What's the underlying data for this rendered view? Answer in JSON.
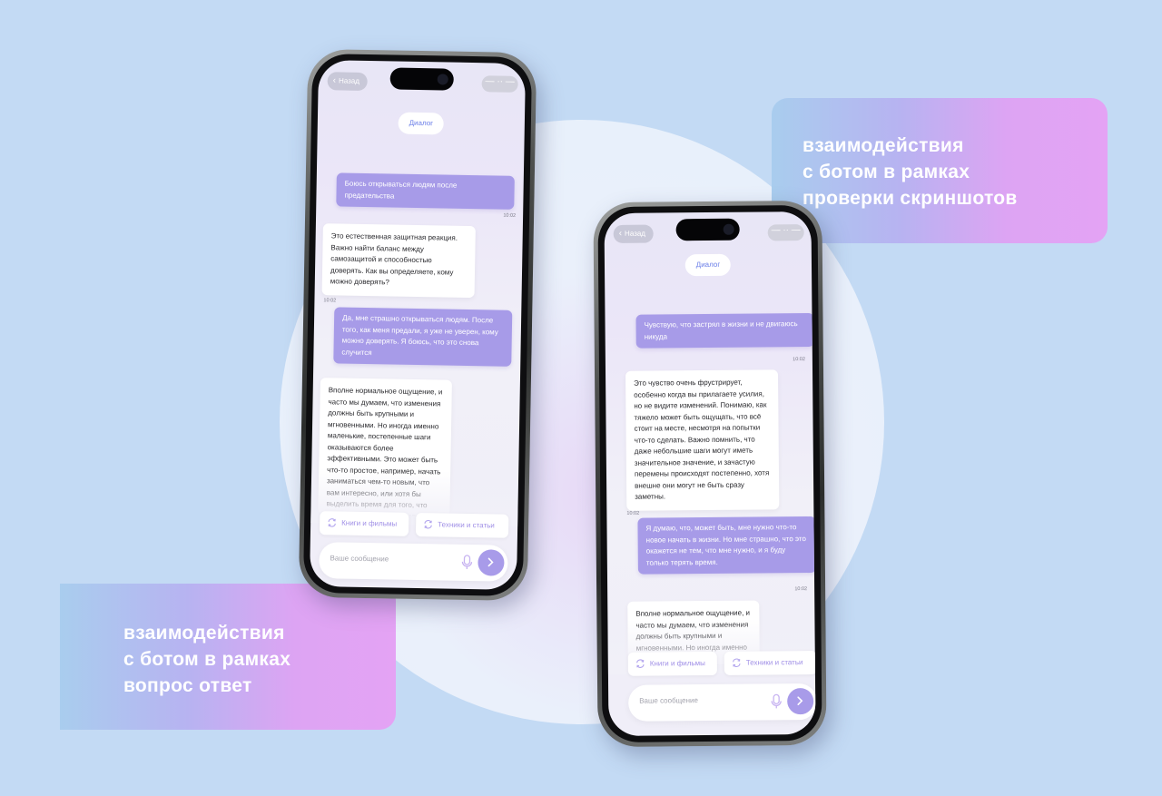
{
  "captions": {
    "right": [
      "взаимодействия",
      "с ботом в рамках",
      "проверки скриншотов"
    ],
    "left": [
      "взаимодействия",
      "с ботом в рамках",
      "вопрос ответ"
    ]
  },
  "phone1": {
    "back_label": "Назад",
    "right_pill": "— ·· —",
    "title": "Диалог",
    "messages": [
      {
        "role": "user",
        "text": "Боюсь открываться людям после предательства",
        "time": "10:02"
      },
      {
        "role": "bot",
        "text": "Это естественная защитная реакция. Важно найти баланс между самозащитой и способностью доверять. Как вы определяете, кому можно доверять?",
        "time": "10:02"
      },
      {
        "role": "user",
        "text": "Да, мне страшно открываться людям. После того, как меня предали, я уже не уверен, кому можно доверять. Я боюсь, что это снова случится",
        "time": ""
      },
      {
        "role": "bot",
        "text": "Вполне нормальное ощущение, и часто мы думаем, что изменения должны быть крупными и мгновенными. Но иногда именно маленькие, постепенные шаги оказываются более эффективными. Это может быть что-то простое, например, начать заниматься чем-то новым, что вам интересно, или хотя бы выделить время для того, что приносит радость. Бывает ли у",
        "time": ""
      }
    ],
    "chips": [
      "Книги и фильмы",
      "Техники и статьи"
    ],
    "input_placeholder": "Ваше сообщение"
  },
  "phone2": {
    "back_label": "Назад",
    "right_pill": "— ·· —",
    "title": "Диалог",
    "messages": [
      {
        "role": "user",
        "text": "Чувствую, что застрял в жизни и не двигаюсь никуда",
        "time": "10:02"
      },
      {
        "role": "bot",
        "text": "Это чувство очень фрустрирует, особенно когда вы прилагаете усилия, но не видите изменений. Понимаю, как тяжело может быть ощущать, что всё стоит на месте, несмотря на попытки что-то сделать. Важно помнить, что даже небольшие шаги могут иметь значительное значение, и зачастую перемены происходят постепенно, хотя внешне они могут не быть сразу заметны.",
        "time": "10:02"
      },
      {
        "role": "user",
        "text": "Я думаю, что, может быть, мне нужно что-то новое начать в жизни. Но мне страшно, что это окажется не тем, что мне нужно, и я буду только терять время.",
        "time": "10:02"
      },
      {
        "role": "bot",
        "text": "Вполне нормальное ощущение, и часто мы думаем, что изменения должны быть крупными и мгновенными. Но иногда именно",
        "time": ""
      }
    ],
    "chips": [
      "Книги и фильмы",
      "Техники и статьи"
    ],
    "input_placeholder": "Ваше сообщение"
  }
}
